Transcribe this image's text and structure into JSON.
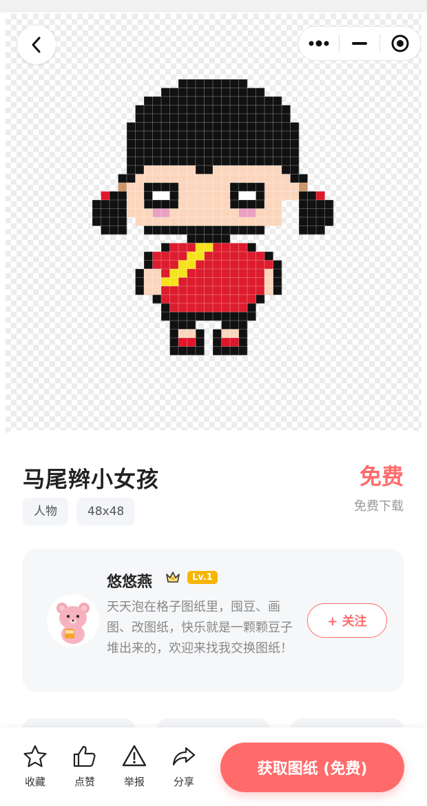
{
  "item": {
    "title": "马尾辫小女孩",
    "price_label": "免费",
    "price_sub": "免费下载",
    "tags": [
      "人物",
      "48x48"
    ]
  },
  "author": {
    "name": "悠悠燕",
    "level": "Lv.1",
    "bio": "天天泡在格子图纸里，囤豆、画图、改图纸，快乐就是一颗颗豆子堆出来的，欢迎来找我交换图纸！",
    "follow_label": "+ 关注"
  },
  "actions": {
    "favorite": "收藏",
    "like": "点赞",
    "report": "举报",
    "share": "分享"
  },
  "cta": {
    "label": "获取图纸 (免费)"
  },
  "colors": {
    "accent": "#ff6b6b",
    "black": "#111111",
    "skin": "#fbd6bd",
    "dress_red": "#dd1c2e",
    "yellow": "#f5e21c",
    "pink": "#eaa0c0",
    "brown": "#c8956c",
    "shoe_red": "#e0162b"
  },
  "icons": [
    "back-icon",
    "more-dots-icon",
    "minimize-icon",
    "close-target-icon",
    "star-icon",
    "thumbs-up-icon",
    "warning-icon",
    "share-icon",
    "crown-icon"
  ]
}
